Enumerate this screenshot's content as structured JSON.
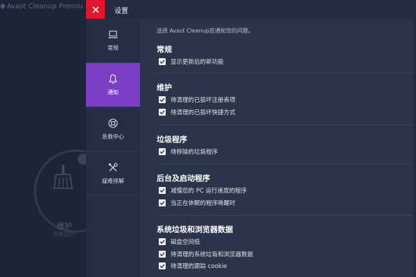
{
  "background": {
    "app_title": "Avast Cleanup Premiu",
    "center_label": "维护",
    "center_sublabel": "所有运行"
  },
  "header": {
    "title": "设置",
    "close_glyph": "×"
  },
  "nav": {
    "items": [
      {
        "label": "常规",
        "icon": "laptop-icon",
        "active": false
      },
      {
        "label": "通知",
        "icon": "bell-icon",
        "active": true
      },
      {
        "label": "急救中心",
        "icon": "lifebuoy-icon",
        "active": false
      },
      {
        "label": "疑难排解",
        "icon": "tools-icon",
        "active": false
      }
    ]
  },
  "content": {
    "intro": "选择 Avast Cleanup应通知您的问题。",
    "sections": [
      {
        "title": "常规",
        "options": [
          {
            "label": "显示更新后的新功能",
            "checked": true
          }
        ]
      },
      {
        "title": "维护",
        "options": [
          {
            "label": "待清理的已损坏注册表项",
            "checked": true
          },
          {
            "label": "待清理的已损坏快捷方式",
            "checked": true
          }
        ]
      },
      {
        "title": "垃圾程序",
        "options": [
          {
            "label": "待移除的垃圾程序",
            "checked": true
          }
        ]
      },
      {
        "title": "后台及启动程序",
        "options": [
          {
            "label": "减慢您的 PC 运行速度的程序",
            "checked": true
          },
          {
            "label": "当正在休眠的程序唤醒时",
            "checked": true
          }
        ]
      },
      {
        "title": "系统垃圾和浏览器数据",
        "options": [
          {
            "label": "磁盘空间低",
            "checked": true
          },
          {
            "label": "待清理的系统垃圾和浏览器数据",
            "checked": true
          },
          {
            "label": "待清理的跟踪 cookie",
            "checked": true
          }
        ]
      }
    ]
  },
  "colors": {
    "accent": "#7b3fc6",
    "close": "#e5162c",
    "check": "#2b3449"
  }
}
